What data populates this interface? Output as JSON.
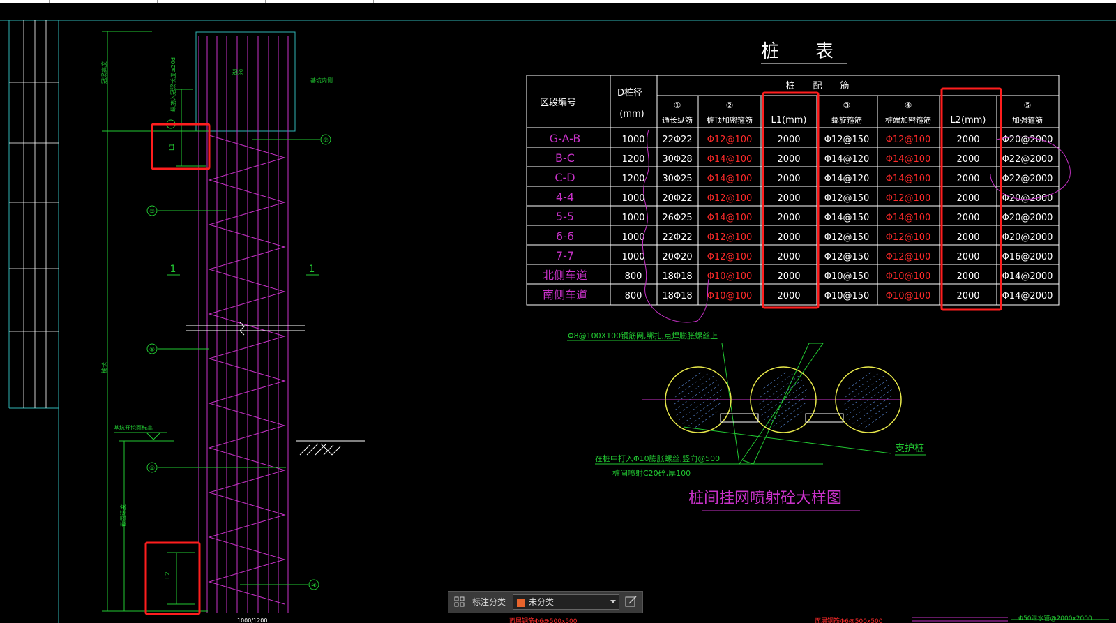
{
  "pile_table": {
    "title": "桩　　表",
    "header": {
      "col_section": "区段编号",
      "col_d1": "D桩径",
      "col_d2": "(mm)",
      "group": "桩　　配　　筋",
      "sub": [
        {
          "num": "①",
          "label": "通长纵筋"
        },
        {
          "num": "②",
          "label": "桩顶加密箍筋"
        },
        {
          "num": "",
          "label": "L1(mm)"
        },
        {
          "num": "③",
          "label": "螺旋箍筋"
        },
        {
          "num": "④",
          "label": "桩端加密箍筋"
        },
        {
          "num": "",
          "label": "L2(mm)"
        },
        {
          "num": "⑤",
          "label": "加强箍筋"
        }
      ]
    },
    "rows": [
      [
        "G-A-B",
        "1000",
        "22Φ22",
        "Φ12@100",
        "2000",
        "Φ12@150",
        "Φ12@100",
        "2000",
        "Φ20@2000"
      ],
      [
        "B-C",
        "1200",
        "30Φ28",
        "Φ14@100",
        "2000",
        "Φ14@120",
        "Φ14@100",
        "2000",
        "Φ22@2000"
      ],
      [
        "C-D",
        "1200",
        "30Φ25",
        "Φ14@100",
        "2000",
        "Φ14@120",
        "Φ14@100",
        "2000",
        "Φ22@2000"
      ],
      [
        "4-4",
        "1000",
        "20Φ22",
        "Φ12@100",
        "2000",
        "Φ12@150",
        "Φ12@100",
        "2000",
        "Φ20@2000"
      ],
      [
        "5-5",
        "1000",
        "26Φ25",
        "Φ14@100",
        "2000",
        "Φ14@150",
        "Φ14@100",
        "2000",
        "Φ20@2000"
      ],
      [
        "6-6",
        "1000",
        "22Φ22",
        "Φ12@100",
        "2000",
        "Φ12@150",
        "Φ12@100",
        "2000",
        "Φ20@2000"
      ],
      [
        "7-7",
        "1000",
        "20Φ20",
        "Φ12@100",
        "2000",
        "Φ12@150",
        "Φ12@100",
        "2000",
        "Φ16@2000"
      ],
      [
        "北侧车道",
        "800",
        "18Φ18",
        "Φ10@100",
        "2000",
        "Φ10@150",
        "Φ10@100",
        "2000",
        "Φ14@2000"
      ],
      [
        "南侧车道",
        "800",
        "18Φ18",
        "Φ10@100",
        "2000",
        "Φ10@150",
        "Φ10@100",
        "2000",
        "Φ14@2000"
      ]
    ]
  },
  "elevation": {
    "markers": [
      "②",
      "③",
      "⑤",
      "①",
      "④"
    ],
    "section_marks": [
      "1",
      "1"
    ],
    "dim_l1": "L1",
    "dim_l2": "L2",
    "label_capbeam": "冠梁",
    "label_note_top": "纵筋入冠梁长度≥20d",
    "label_side_right": "基坑内侧",
    "label_top_dim": "冠梁高度",
    "label_pile": "桩长",
    "label_embed": "嵌固深度",
    "label_bottom": "基坑开挖面标高",
    "label_dia": "1000/1200"
  },
  "detail": {
    "title": "桩间挂网喷射砼大样图",
    "note_mesh": "Φ8@100X100钢筋网,绑扎,点焊膨胀螺丝上",
    "note_bolt": "在桩中打入Φ10膨胀螺丝,竖向@500",
    "note_spray": "桩间喷射C20砼,厚100",
    "label_pile": "支护桩"
  },
  "toolbar": {
    "label": "标注分类",
    "value": "未分类",
    "swatch_color": "#e8642c",
    "grid_icon": "grid-icon",
    "edit_icon": "edit-icon"
  },
  "bottom_fragments": {
    "a": "面层钢筋Φ6@500x500",
    "b": "Φ50泄水管@2000x2000"
  },
  "colors": {
    "table_line": "#ffffff",
    "text_white": "#ffffff",
    "text_red": "#ff2a2a",
    "magenta": "#c832c8",
    "green": "#22c832",
    "highlight": "#ff1e1e"
  }
}
